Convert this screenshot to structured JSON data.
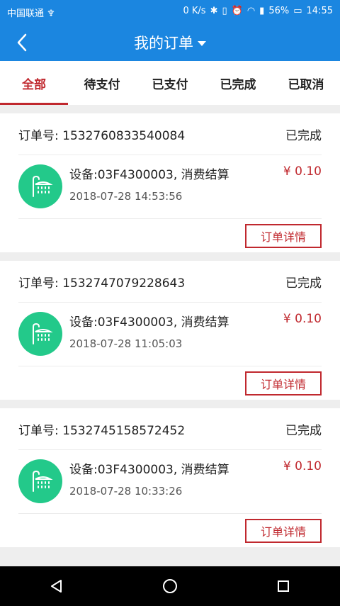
{
  "status_bar": {
    "carrier": "中国联通 ♆",
    "speed": "0 K/s",
    "battery": "56%",
    "time": "14:55"
  },
  "header": {
    "title": "我的订单",
    "back_icon": "back-icon",
    "dropdown_icon": "caret-down-icon"
  },
  "tabs": [
    {
      "label": "全部",
      "active": true
    },
    {
      "label": "待支付",
      "active": false
    },
    {
      "label": "已支付",
      "active": false
    },
    {
      "label": "已完成",
      "active": false
    },
    {
      "label": "已取消",
      "active": false
    }
  ],
  "orders": [
    {
      "order_no": "订单号: 1532760833540084",
      "status": "已完成",
      "desc": "设备:03F4300003, 消费结算",
      "time": "2018-07-28 14:53:56",
      "price": "¥ 0.10",
      "detail_label": "订单详情"
    },
    {
      "order_no": "订单号: 1532747079228643",
      "status": "已完成",
      "desc": "设备:03F4300003, 消费结算",
      "time": "2018-07-28 11:05:03",
      "price": "¥ 0.10",
      "detail_label": "订单详情"
    },
    {
      "order_no": "订单号: 1532745158572452",
      "status": "已完成",
      "desc": "设备:03F4300003, 消费结算",
      "time": "2018-07-28 10:33:26",
      "price": "¥ 0.10",
      "detail_label": "订单详情"
    }
  ],
  "colors": {
    "primary": "#1b86e0",
    "accent": "#c0282e",
    "icon_bg": "#23c98a"
  }
}
